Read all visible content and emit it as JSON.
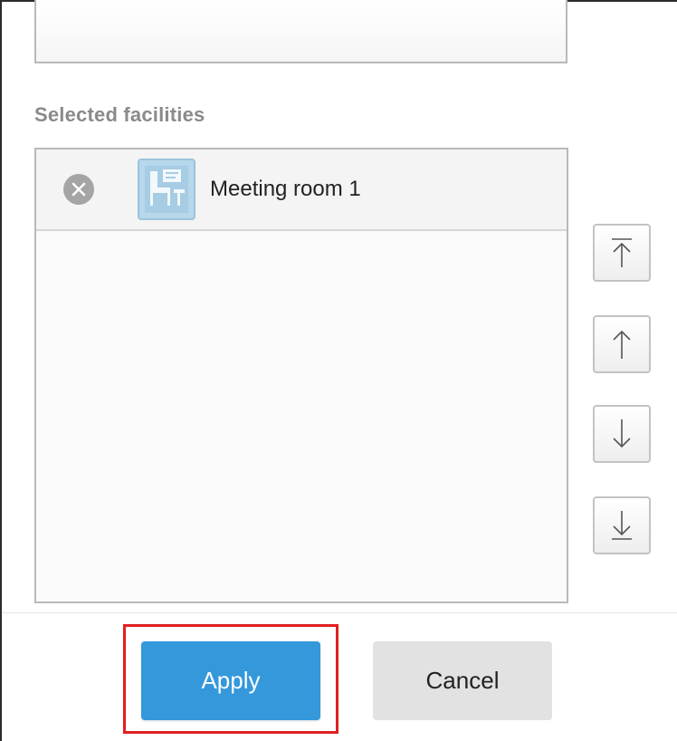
{
  "section": {
    "label": "Selected facilities"
  },
  "selected_items": [
    {
      "name": "Meeting room 1",
      "icon": "facility-icon"
    }
  ],
  "order_controls": {
    "move_top_icon": "arrow-to-top-icon",
    "move_up_icon": "arrow-up-icon",
    "move_down_icon": "arrow-down-icon",
    "move_bottom_icon": "arrow-to-bottom-icon"
  },
  "footer": {
    "apply_label": "Apply",
    "cancel_label": "Cancel"
  },
  "colors": {
    "apply": "#3498db",
    "cancel": "#e2e2e2",
    "highlight": "#e02020"
  }
}
